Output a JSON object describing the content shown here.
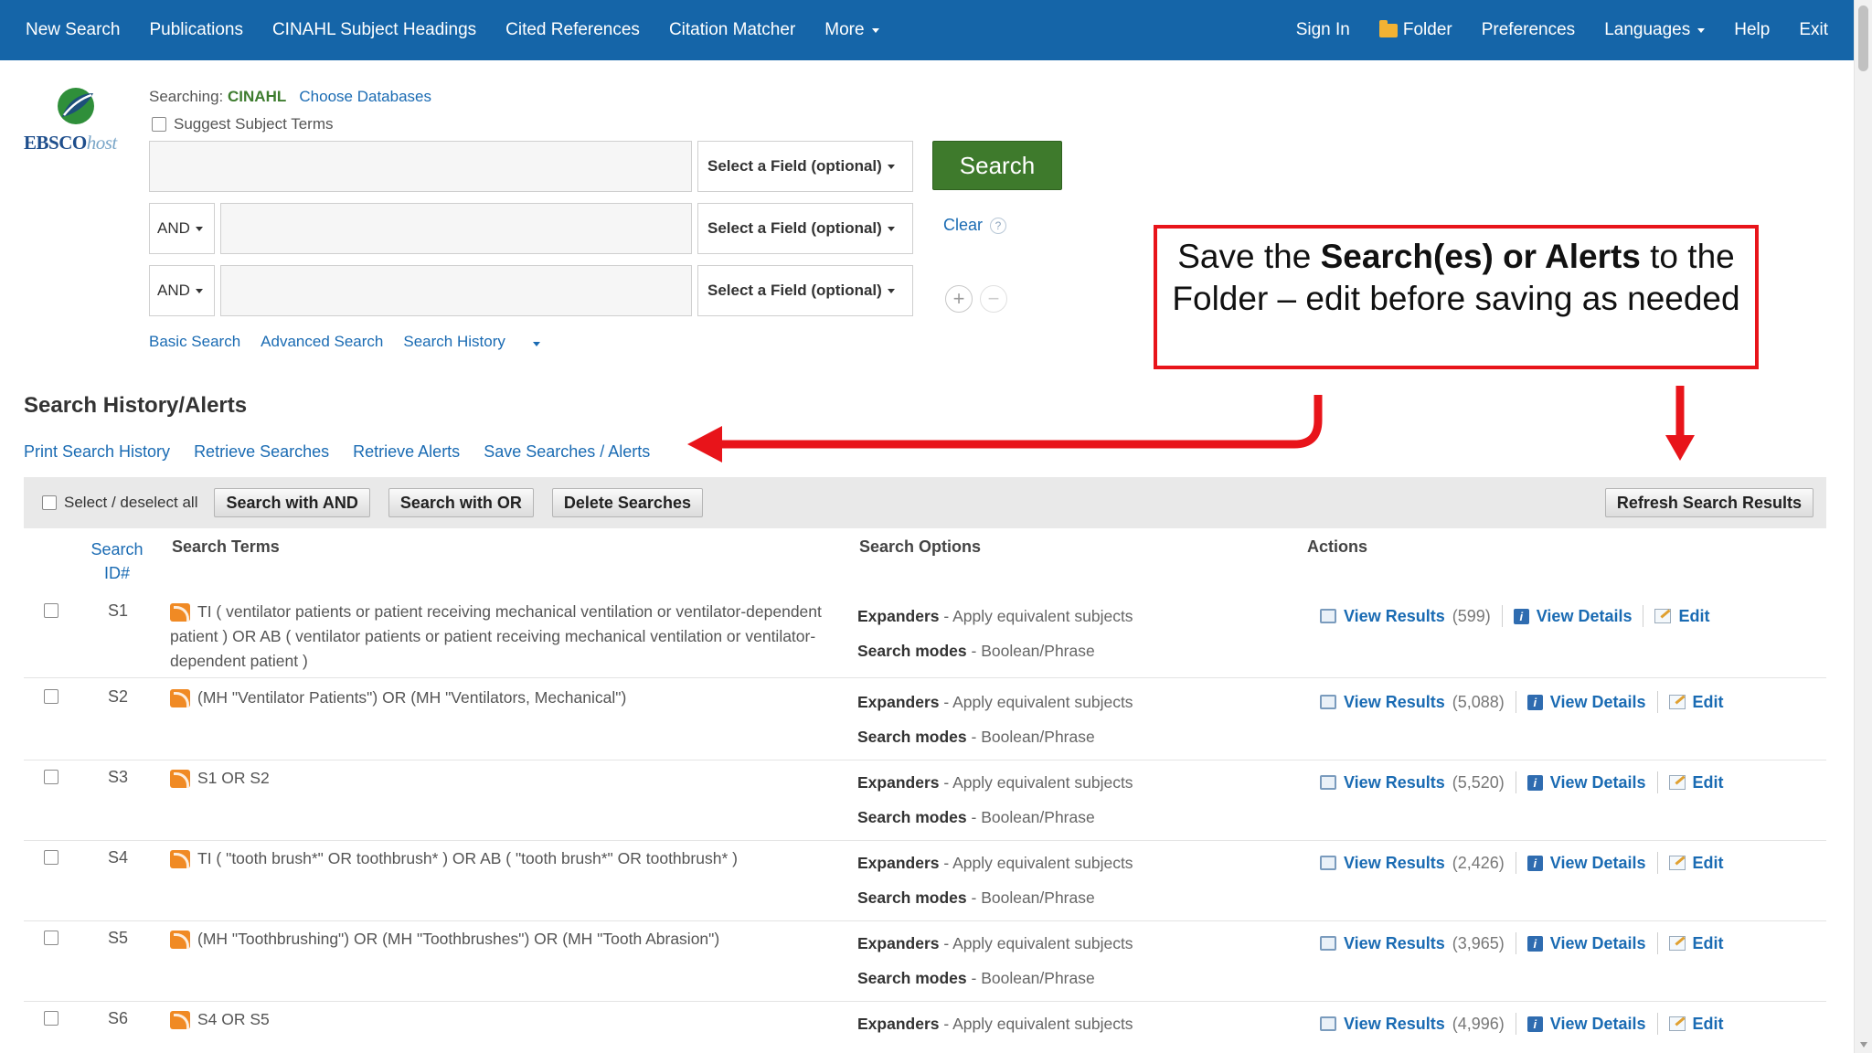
{
  "nav": {
    "left": [
      "New Search",
      "Publications",
      "CINAHL Subject Headings",
      "Cited References",
      "Citation Matcher",
      "More"
    ],
    "right": [
      "Sign In",
      "Folder",
      "Preferences",
      "Languages",
      "Help",
      "Exit"
    ]
  },
  "logo": {
    "brand": "EBSCO",
    "suffix": "host"
  },
  "search": {
    "searching_label": "Searching:",
    "database": "CINAHL",
    "choose_databases": "Choose Databases",
    "suggest_label": "Suggest Subject Terms",
    "field_placeholder": "Select a Field (optional)",
    "bool_op": "AND",
    "search_button": "Search",
    "clear": "Clear",
    "help": "?",
    "add": "+",
    "remove": "−",
    "links": {
      "basic": "Basic Search",
      "advanced": "Advanced Search",
      "history": "Search History"
    }
  },
  "callout": {
    "part1": "Save the ",
    "bold": "Search(es) or  Alerts",
    "part2": " to the Folder – edit before saving as needed",
    "arrow_color": "#e8141a"
  },
  "history": {
    "title": "Search History/Alerts",
    "links": [
      "Print Search History",
      "Retrieve Searches",
      "Retrieve Alerts",
      "Save Searches / Alerts"
    ],
    "select_all": "Select / deselect all",
    "buttons": {
      "and": "Search with AND",
      "or": "Search with OR",
      "delete": "Delete Searches",
      "refresh": "Refresh Search Results"
    },
    "columns": {
      "id_line1": "Search",
      "id_line2": "ID#",
      "terms": "Search Terms",
      "options": "Search Options",
      "actions": "Actions"
    },
    "labels": {
      "expanders": "Expanders",
      "expanders_value": " - Apply equivalent subjects",
      "modes": "Search modes",
      "modes_value": " - Boolean/Phrase",
      "view_results": "View Results",
      "view_details": "View Details",
      "edit": "Edit"
    },
    "rows": [
      {
        "id": "S1",
        "terms": "TI ( ventilator patients or patient receiving mechanical ventilation or ventilator-dependent patient ) OR AB ( ventilator patients or patient receiving mechanical ventilation or ventilator-dependent patient )",
        "count": "(599)"
      },
      {
        "id": "S2",
        "terms": "(MH \"Ventilator Patients\") OR (MH \"Ventilators, Mechanical\")",
        "count": "(5,088)"
      },
      {
        "id": "S3",
        "terms": "S1 OR S2",
        "count": "(5,520)"
      },
      {
        "id": "S4",
        "terms": "TI ( \"tooth brush*\" OR toothbrush* ) OR AB ( \"tooth brush*\" OR toothbrush* )",
        "count": "(2,426)"
      },
      {
        "id": "S5",
        "terms": "(MH \"Toothbrushing\") OR (MH \"Toothbrushes\") OR (MH \"Tooth Abrasion\")",
        "count": "(3,965)"
      },
      {
        "id": "S6",
        "terms": "S4 OR S5",
        "count": "(4,996)"
      }
    ]
  }
}
